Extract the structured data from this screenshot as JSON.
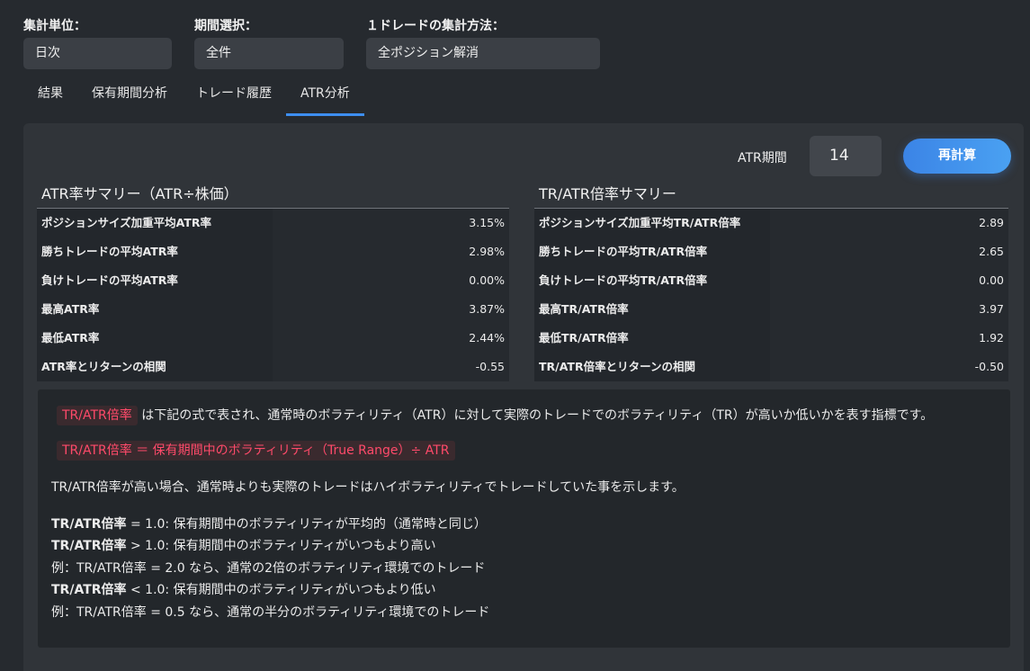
{
  "filters": [
    {
      "label": "集計単位：",
      "value": "日次"
    },
    {
      "label": "期間選択：",
      "value": "全件"
    },
    {
      "label": "１ドレードの集計方法：",
      "value": "全ポジション解消"
    }
  ],
  "tabs": [
    {
      "label": "結果",
      "active": false
    },
    {
      "label": "保有期間分析",
      "active": false
    },
    {
      "label": "トレード履歴",
      "active": false
    },
    {
      "label": "ATR分析",
      "active": true
    }
  ],
  "atr": {
    "period_label": "ATR期間",
    "period_value": "14",
    "recalc_label": "再計算"
  },
  "atr_summary": {
    "title": "ATR率サマリー（ATR÷株価）",
    "rows": [
      {
        "label": "ポジションサイズ加重平均ATR率",
        "value": "3.15%"
      },
      {
        "label": "勝ちトレードの平均ATR率",
        "value": "2.98%"
      },
      {
        "label": "負けトレードの平均ATR率",
        "value": "0.00%"
      },
      {
        "label": "最高ATR率",
        "value": "3.87%"
      },
      {
        "label": "最低ATR率",
        "value": "2.44%"
      },
      {
        "label": "ATR率とリターンの相関",
        "value": "-0.55"
      }
    ]
  },
  "tr_summary": {
    "title": "TR/ATR倍率サマリー",
    "rows": [
      {
        "label": "ポジションサイズ加重平均TR/ATR倍率",
        "value": "2.89"
      },
      {
        "label": "勝ちトレードの平均TR/ATR倍率",
        "value": "2.65"
      },
      {
        "label": "負けトレードの平均TR/ATR倍率",
        "value": "0.00"
      },
      {
        "label": "最高TR/ATR倍率",
        "value": "3.97"
      },
      {
        "label": "最低TR/ATR倍率",
        "value": "1.92"
      },
      {
        "label": "TR/ATR倍率とリターンの相関",
        "value": "-0.50"
      }
    ]
  },
  "info": {
    "tag1": "TR/ATR倍率",
    "line1_rest": "は下記の式で表され、通常時のボラティリティ（ATR）に対して実際のトレードでのボラティリティ（TR）が高いか低いかを表す指標です。",
    "formula": "TR/ATR倍率 ＝ 保有期間中のボラティリティ（True Range）÷ ATR",
    "line3": "TR/ATR倍率が高い場合、通常時よりも実際のトレードはハイボラティリティでトレードしていた事を示します。",
    "list": [
      {
        "bold": "TR/ATR倍率",
        "rest": " = 1.0: 保有期間中のボラティリティが平均的（通常時と同じ）"
      },
      {
        "bold": "TR/ATR倍率",
        "rest": " > 1.0: 保有期間中のボラティリティがいつもより高い"
      },
      {
        "bold": "",
        "rest": "例：TR/ATR倍率 = 2.0 なら、通常の2倍のボラティリティ環境でのトレード"
      },
      {
        "bold": "TR/ATR倍率",
        "rest": " < 1.0: 保有期間中のボラティリティがいつもより低い"
      },
      {
        "bold": "",
        "rest": "例：TR/ATR倍率 = 0.5 なら、通常の半分のボラティリティ環境でのトレード"
      }
    ]
  }
}
